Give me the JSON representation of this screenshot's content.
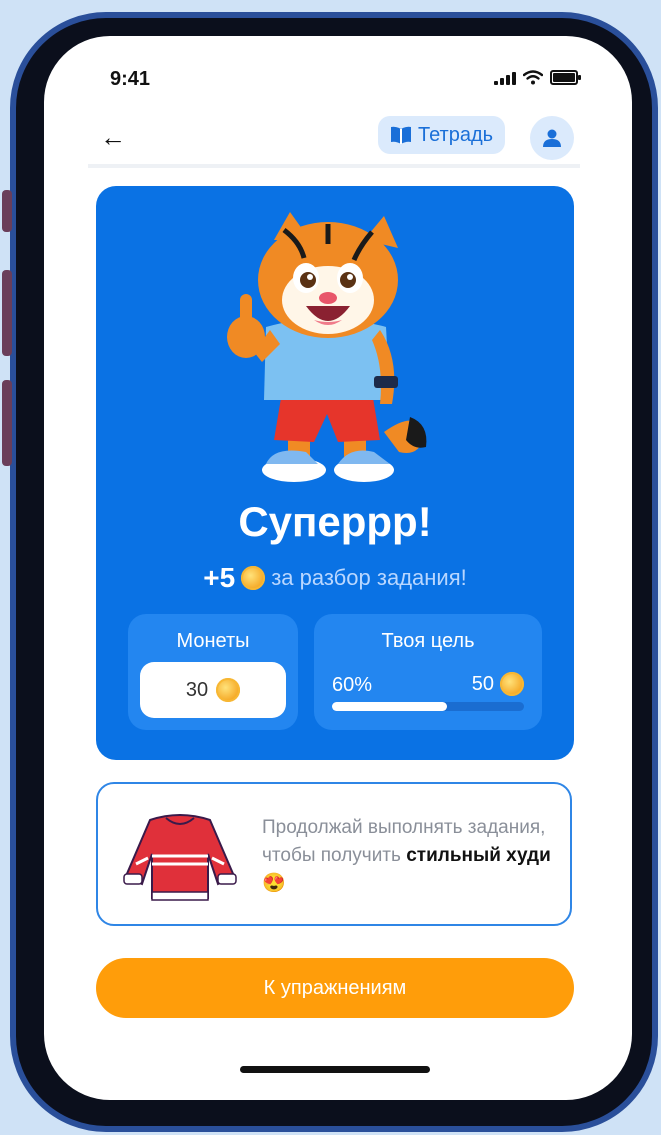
{
  "status_bar": {
    "time": "9:41"
  },
  "header": {
    "back_icon": "arrow-left-icon",
    "notebook_label": "Тетрадь",
    "notebook_icon": "book-icon",
    "profile_icon": "user-icon"
  },
  "reward": {
    "mascot": "tiger-thumbs-up",
    "headline": "Суперрр!",
    "amount": "+5",
    "text": "за разбор задания!"
  },
  "coins": {
    "label": "Монеты",
    "value": "30"
  },
  "goal": {
    "label": "Твоя цель",
    "percent_label": "60%",
    "progress": 0.6,
    "target": "50"
  },
  "hoodie": {
    "text": "Продолжай выполнять задания, чтобы получить",
    "strong": "стильный худи",
    "emoji": "😍"
  },
  "cta": {
    "label": "К упражнениям"
  },
  "colors": {
    "primary_blue": "#0a72e4",
    "accent_orange": "#ff9d0a",
    "coin_gold": "#f5a623"
  }
}
